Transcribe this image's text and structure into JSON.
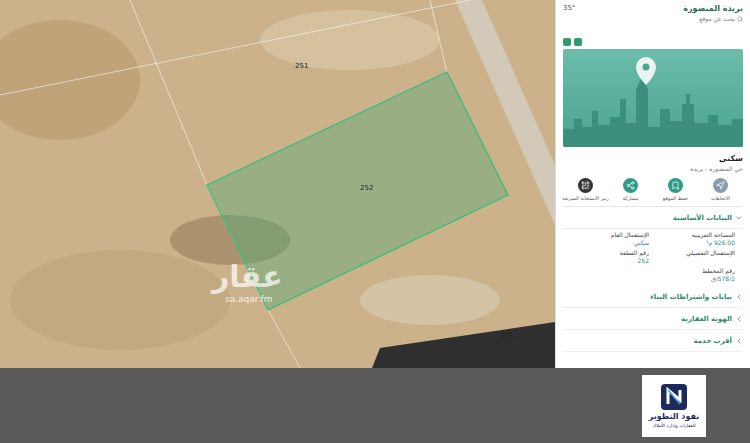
{
  "map": {
    "parcels": [
      {
        "number": "251",
        "selected": false
      },
      {
        "number": "252",
        "selected": true
      },
      {
        "number": "253",
        "selected": false
      }
    ],
    "watermark": {
      "logo": "عقار",
      "url": "sa.aqar.fm"
    }
  },
  "panel": {
    "title": "بريدة المنصورة",
    "subtitle": "بحث عن موقع",
    "temperature": "35°",
    "category": "سكني",
    "location": "حي المنصورة - بريدة",
    "actions": [
      {
        "label": "الاتجاهات",
        "color": "#8a9bb0"
      },
      {
        "label": "حفظ الموقع",
        "color": "#2f9b86"
      },
      {
        "label": "مشاركة",
        "color": "#2f9b86"
      },
      {
        "label": "رمز الاستجابة السريعة",
        "color": "#333333"
      }
    ],
    "basic_data": {
      "title": "البيانات الأساسية",
      "expanded": true,
      "fields": [
        {
          "label": "المساحة التقريبية",
          "value": "926.00 م²"
        },
        {
          "label": "الإستعمال العام",
          "value": "سكني"
        },
        {
          "label": "الإستعمال التفصيلي"
        },
        {
          "label": "رقم القطعة",
          "value": "252"
        },
        {
          "label": "رقم المخطط",
          "value": "578/2/ق"
        }
      ]
    },
    "sections": [
      {
        "title": "بيانات واشتراطات البناء",
        "expanded": false
      },
      {
        "title": "الهوية العقارية",
        "expanded": false
      },
      {
        "title": "أقرب خدمة",
        "expanded": false
      }
    ]
  },
  "footer": {
    "logo": {
      "name": "نفوذ التطوير",
      "tagline": "للعقارات وإدارة الأملاك"
    }
  }
}
